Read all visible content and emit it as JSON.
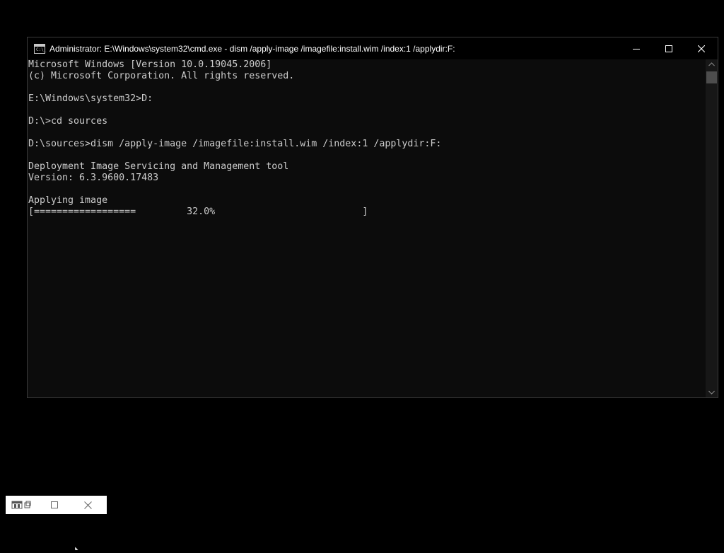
{
  "window": {
    "title": "Administrator: E:\\Windows\\system32\\cmd.exe - dism  /apply-image /imagefile:install.wim /index:1 /applydir:F:",
    "icon_text": "C:\\_",
    "controls": [
      "minimize-icon",
      "maximize-icon",
      "close-icon"
    ]
  },
  "console": {
    "lines": [
      "Microsoft Windows [Version 10.0.19045.2006]",
      "(c) Microsoft Corporation. All rights reserved.",
      "",
      "E:\\Windows\\system32>D:",
      "",
      "D:\\>cd sources",
      "",
      "D:\\sources>dism /apply-image /imagefile:install.wim /index:1 /applydir:F:",
      "",
      "Deployment Image Servicing and Management tool",
      "Version: 6.3.9600.17483",
      "",
      "Applying image",
      "[==================         32.0%                          ]"
    ],
    "progress": 0.32,
    "colors": {
      "background": "#0c0c0c",
      "text": "#cccccc"
    }
  },
  "minimized_window": {
    "icons": [
      "restore-icon",
      "maximize-icon",
      "close-icon"
    ]
  }
}
